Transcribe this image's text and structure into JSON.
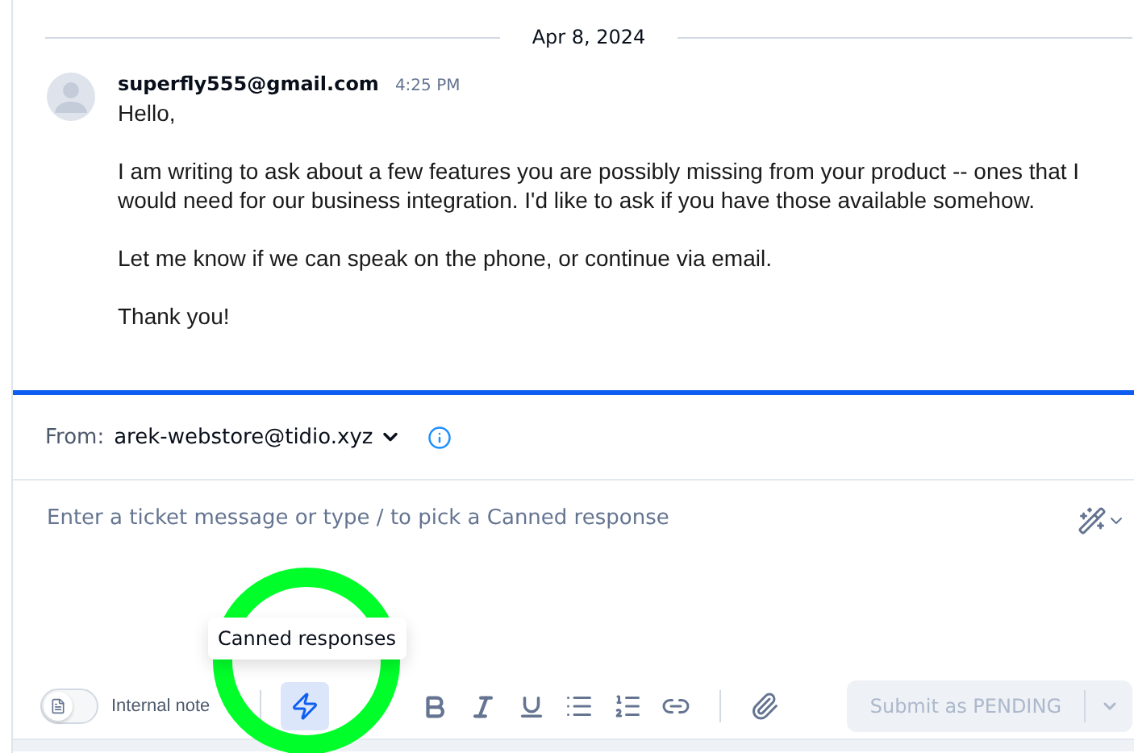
{
  "date_divider": "Apr 8, 2024",
  "message": {
    "sender": "superfly555@gmail.com",
    "time": "4:25 PM",
    "paragraphs": [
      "Hello,",
      "I am writing to ask about a few features you are possibly missing from your product -- ones that I would need for our business integration. I'd like to ask if you have those available somehow.",
      "Let me know if we can speak on the phone, or continue via email.",
      "Thank you!"
    ]
  },
  "composer": {
    "from_label": "From:",
    "from_address": "arek-webstore@tidio.xyz",
    "placeholder": "Enter a ticket message or type / to pick a Canned response"
  },
  "toolbar": {
    "internal_note": {
      "label": "Internal note",
      "on": false
    },
    "canned_selected": true,
    "tooltip": "Canned responses",
    "submit": {
      "label": "Submit as PENDING",
      "disabled": true
    }
  },
  "highlight": {
    "shown": true
  }
}
